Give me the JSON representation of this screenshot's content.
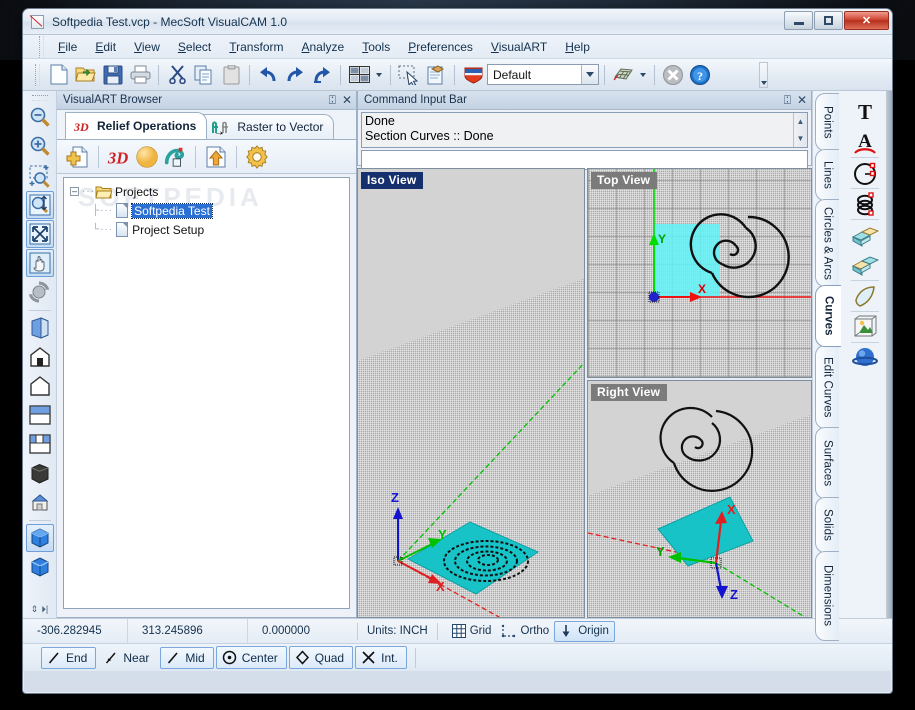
{
  "watermark": "SOFTPEDIA",
  "window": {
    "title": "Softpedia Test.vcp - MecSoft VisualCAM 1.0",
    "app_icon": "document-slash-icon",
    "buttons": {
      "minimize": "minimize-icon",
      "maximize": "maximize-icon",
      "close": "✕"
    }
  },
  "menu": [
    {
      "label": "File",
      "accel": "F"
    },
    {
      "label": "Edit",
      "accel": "E"
    },
    {
      "label": "View",
      "accel": "V"
    },
    {
      "label": "Select",
      "accel": "S"
    },
    {
      "label": "Transform",
      "accel": "T"
    },
    {
      "label": "Analyze",
      "accel": "A"
    },
    {
      "label": "Tools",
      "accel": "T"
    },
    {
      "label": "Preferences",
      "accel": "P"
    },
    {
      "label": "VisualART",
      "accel": "V"
    },
    {
      "label": "Help",
      "accel": "H"
    }
  ],
  "toolbar": {
    "buttons": [
      "new-icon",
      "open-icon",
      "save-icon",
      "print-icon",
      "cut-icon",
      "copy-icon",
      "paste-icon",
      "undo-icon",
      "redo-icon",
      "repeat-icon",
      "viewport-layout-icon",
      "select-window-icon",
      "properties-icon"
    ],
    "layer_combo_value": "Default",
    "layer_combo_icon": "layer-icon",
    "mesh_icon": "mesh-icon",
    "delete_icon": "delete-icon",
    "help_icon": "help-icon"
  },
  "browser": {
    "title": "VisualART Browser",
    "pin": "pin-icon",
    "close": "close-icon",
    "tabs": [
      {
        "label": "Relief Operations",
        "icon": "3d-relief-icon",
        "active": true
      },
      {
        "label": "Raster to Vector",
        "icon": "raster-to-vector-icon",
        "active": false
      }
    ],
    "tool_icons": [
      "add-document-icon",
      "3d-relief-icon",
      "sphere-relief-icon",
      "shape-relief-icon",
      "export-up-icon",
      "settings-gear-icon"
    ],
    "tree": {
      "root": {
        "label": "Projects",
        "icon": "folder-icon",
        "expander": "-"
      },
      "children": [
        {
          "label": "Softpedia Test",
          "icon": "file-icon",
          "selected": true
        },
        {
          "label": "Project Setup",
          "icon": "file-icon",
          "selected": false
        }
      ]
    }
  },
  "command_bar": {
    "title": "Command Input Bar",
    "pin": "pin-icon",
    "close": "close-icon",
    "history": [
      "Done",
      "Section Curves :: Done"
    ],
    "input_value": "",
    "scroll_up": "scroll-up-icon",
    "scroll_down": "scroll-down-icon"
  },
  "viewports": [
    {
      "name": "iso-view",
      "label": "Iso View",
      "active": true,
      "axes": [
        {
          "name": "X",
          "color": "#e02020"
        },
        {
          "name": "Y",
          "color": "#00c000"
        },
        {
          "name": "Z",
          "color": "#1414d0"
        }
      ],
      "objects": [
        "cyan-plane",
        "black-spiral-curve"
      ]
    },
    {
      "name": "top-view",
      "label": "Top View",
      "active": false,
      "axes": [
        {
          "name": "X",
          "color": "#e02020"
        },
        {
          "name": "Y",
          "color": "#00c000"
        }
      ],
      "objects": [
        "cyan-plane",
        "black-spiral-curve"
      ]
    },
    {
      "name": "right-view",
      "label": "Right View",
      "active": false,
      "axes": [
        {
          "name": "X",
          "color": "#e02020"
        },
        {
          "name": "Y",
          "color": "#00c000"
        },
        {
          "name": "Z",
          "color": "#1414d0"
        }
      ],
      "objects": [
        "cyan-plane",
        "black-spiral-curve"
      ]
    }
  ],
  "left_toolbar": {
    "icons": [
      {
        "name": "zoom-out-icon",
        "selected": false
      },
      {
        "name": "zoom-in-icon",
        "selected": false
      },
      {
        "name": "zoom-window-icon",
        "selected": false
      },
      {
        "name": "zoom-dynamic-icon",
        "selected": true
      },
      {
        "name": "zoom-extents-icon",
        "selected": true
      },
      {
        "name": "pan-icon",
        "selected": true
      },
      {
        "name": "rotate-icon",
        "selected": false
      },
      {
        "name": "view-iso-icon",
        "selected": false
      },
      {
        "name": "view-front-icon",
        "selected": false
      },
      {
        "name": "view-back-icon",
        "selected": false
      },
      {
        "name": "view-top-icon",
        "selected": false
      },
      {
        "name": "view-bottom-icon",
        "selected": false
      },
      {
        "name": "shaded-icon",
        "selected": false
      },
      {
        "name": "shaded-house-icon",
        "selected": false
      },
      {
        "name": "render-shaded-icon",
        "selected": true
      },
      {
        "name": "render-wireframe-icon",
        "selected": false
      }
    ]
  },
  "right_panel": {
    "tabs": [
      {
        "label": "Points",
        "active": false
      },
      {
        "label": "Lines",
        "active": false
      },
      {
        "label": "Circles & Arcs",
        "active": false
      },
      {
        "label": "Curves",
        "active": true
      },
      {
        "label": "Edit Curves",
        "active": false
      },
      {
        "label": "Surfaces",
        "active": false
      },
      {
        "label": "Solids",
        "active": false
      },
      {
        "label": "Dimensions",
        "active": false
      }
    ],
    "icons": [
      "text-icon",
      "text-on-arc-icon",
      "arc-curve-icon",
      "spiral-icon",
      "extrude-surface-icon",
      "extrude-surface-2-icon",
      "surface-patch-icon",
      "project-to-box-icon",
      "sphere-icon"
    ]
  },
  "status": {
    "x": "-306.282945",
    "y": "313.245896",
    "z": "0.000000",
    "units_label": "Units: INCH",
    "grid": {
      "label": "Grid",
      "icon": "grid-icon",
      "on": false
    },
    "ortho": {
      "label": "Ortho",
      "icon": "ortho-icon",
      "on": false
    },
    "origin": {
      "label": "Origin",
      "icon": "origin-icon",
      "on": true
    }
  },
  "snaps": [
    {
      "label": "End",
      "icon": "snap-end-icon",
      "on": true
    },
    {
      "label": "Near",
      "icon": "snap-near-icon",
      "on": false
    },
    {
      "label": "Mid",
      "icon": "snap-mid-icon",
      "on": true
    },
    {
      "label": "Center",
      "icon": "snap-center-icon",
      "on": true
    },
    {
      "label": "Quad",
      "icon": "snap-quad-icon",
      "on": true
    },
    {
      "label": "Int.",
      "icon": "snap-intersection-icon",
      "on": true
    }
  ]
}
